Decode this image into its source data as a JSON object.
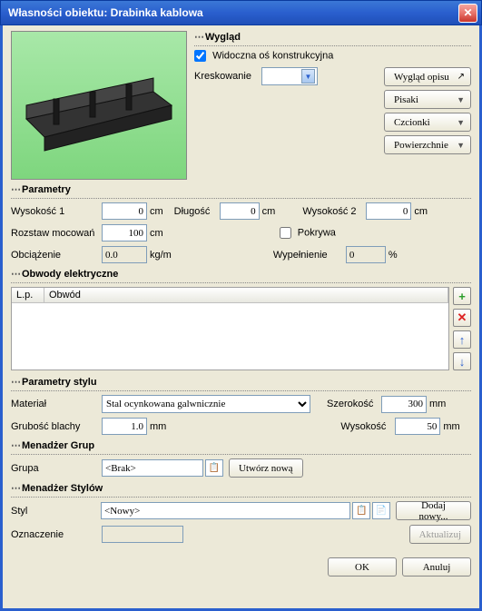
{
  "window": {
    "title": "Własności obiektu: Drabinka kablowa"
  },
  "appearance": {
    "legend": "Wygląd",
    "visible_axis_label": "Widoczna oś konstrukcyjna",
    "visible_axis_checked": true,
    "hatching_label": "Kreskowanie",
    "btn_desc_appearance": "Wygląd opisu",
    "btn_pens": "Pisaki",
    "btn_fonts": "Czcionki",
    "btn_surfaces": "Powierzchnie"
  },
  "parameters": {
    "legend": "Parametry",
    "height1_label": "Wysokość 1",
    "height1_value": "0",
    "height1_unit": "cm",
    "length_label": "Długość",
    "length_value": "0",
    "length_unit": "cm",
    "height2_label": "Wysokość 2",
    "height2_value": "0",
    "height2_unit": "cm",
    "spacing_label": "Rozstaw mocowań",
    "spacing_value": "100",
    "spacing_unit": "cm",
    "cover_label": "Pokrywa",
    "cover_checked": false,
    "load_label": "Obciążenie",
    "load_value": "0.0",
    "load_unit": "kg/m",
    "fill_label": "Wypełnienie",
    "fill_value": "0",
    "fill_unit": "%"
  },
  "circuits": {
    "legend": "Obwody elektryczne",
    "col_lp": "L.p.",
    "col_circuit": "Obwód"
  },
  "style_params": {
    "legend": "Parametry stylu",
    "material_label": "Materiał",
    "material_value": "Stal ocynkowana galwnicznie",
    "width_label": "Szerokość",
    "width_value": "300",
    "width_unit": "mm",
    "thickness_label": "Grubość blachy",
    "thickness_value": "1.0",
    "thickness_unit": "mm",
    "height_label": "Wysokość",
    "height_value": "50",
    "height_unit": "mm"
  },
  "group_mgr": {
    "legend": "Menadżer Grup",
    "group_label": "Grupa",
    "group_value": "<Brak>",
    "create_new": "Utwórz nową"
  },
  "style_mgr": {
    "legend": "Menadżer Stylów",
    "style_label": "Styl",
    "style_value": "<Nowy>",
    "add_new": "Dodaj nowy...",
    "mark_label": "Oznaczenie",
    "mark_value": "",
    "update": "Aktualizuj"
  },
  "footer": {
    "ok": "OK",
    "cancel": "Anuluj"
  }
}
